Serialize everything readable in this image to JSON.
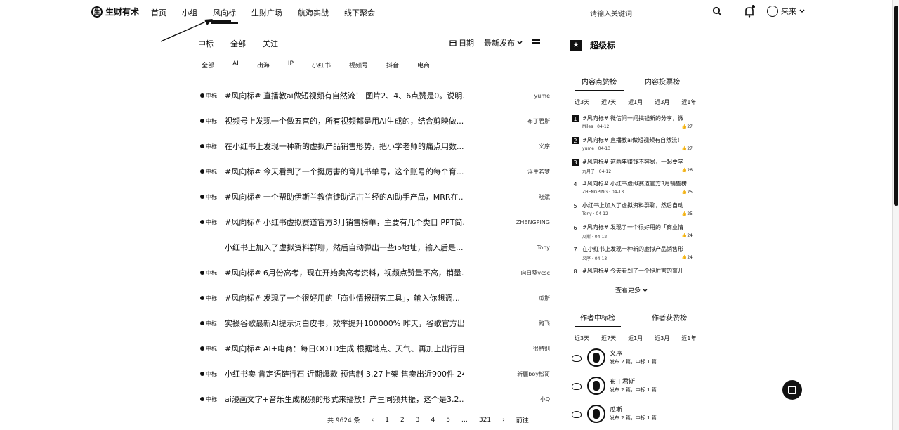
{
  "brand": {
    "name": "生财有术",
    "mark": "生"
  },
  "nav": {
    "items": [
      "首页",
      "小组",
      "风向标",
      "生财广场",
      "航海实战",
      "线下聚会"
    ],
    "active_index": 2
  },
  "search": {
    "placeholder": "请输入关键词"
  },
  "user": {
    "name": "来来"
  },
  "feed": {
    "tabs": [
      "中标",
      "全部",
      "关注"
    ],
    "date_label": "日期",
    "sort_label": "最新发布",
    "categories": [
      "全部",
      "AI",
      "出海",
      "IP",
      "小红书",
      "视频号",
      "抖音",
      "电商"
    ],
    "tag_label": "中标",
    "rows": [
      {
        "tagged": true,
        "title": "#风向标# 直播教ai做短视频有自然流！ 图片2、4、6点赞是0。说明...",
        "author": "yume"
      },
      {
        "tagged": true,
        "title": "视频号上发现一个做五宫的，所有视频都是用AI生成的，结合剪映做...",
        "author": "布丁君斯"
      },
      {
        "tagged": true,
        "title": "在小红书上发现一种新的虚拟产品销售形势，把小学老师的痛点用数...",
        "author": "义序"
      },
      {
        "tagged": true,
        "title": "#风向标# 今天看到了一个挺厉害的育儿书单号，这个账号的每个育...",
        "author": "浮生若梦"
      },
      {
        "tagged": true,
        "title": "#风向标# 一个帮助伊斯兰教信徒助记古兰经的AI助手产品，MRR在...",
        "author": "晓斌"
      },
      {
        "tagged": true,
        "title": "#风向标# 小红书虚拟赛道官方3月销售榜单，主要有几个类目 PPT简...",
        "author": "ZHENGPING"
      },
      {
        "tagged": false,
        "title": "小红书上加入了虚拟资料群聊，然后自动弹出一些ip地址，输入后是...",
        "author": "Tony"
      },
      {
        "tagged": true,
        "title": "#风向标# 6月份高考，现在开始卖高考资料，视频点赞量不高，销量...",
        "author": "向日葵vcsc"
      },
      {
        "tagged": true,
        "title": "#风向标# 发现了一个很好用的「商业情报研究工具」，输入你想调...",
        "author": "瓜斯"
      },
      {
        "tagged": true,
        "title": "实操谷歌最新AI提示词白皮书，效率提升100000% 昨天，谷歌官方出...",
        "author": "路飞"
      },
      {
        "tagged": true,
        "title": "#风向标# AI+电商：每日OOTD生成 根据地点、天气、再加上出行目...",
        "author": "很特别"
      },
      {
        "tagged": true,
        "title": "小红书卖 肯定语链行石 近期爆款 预售制 3.27上架 售卖出近900件 24...",
        "author": "新疆boy松哥"
      },
      {
        "tagged": true,
        "title": "ai漫画文字+音乐生成视频的形式来播放！产生同频共振，这个是3.2...",
        "author": "小Q"
      }
    ]
  },
  "pagination": {
    "total": "共 9624 条",
    "prev": "‹",
    "pages": [
      "1",
      "2",
      "3",
      "4",
      "5",
      "…",
      "321"
    ],
    "next": "›",
    "goto": "前往"
  },
  "sidebar": {
    "title": "超级标",
    "tabs": [
      "内容点赞榜",
      "内容投票榜"
    ],
    "ranges": [
      "近3天",
      "近7天",
      "近1月",
      "近3月",
      "近1年"
    ],
    "ranking": [
      {
        "rank": "1",
        "title": "#风向标# 微信问一问搞钱新的分享，微",
        "author": "Miles",
        "date": "04-12",
        "likes": "27"
      },
      {
        "rank": "2",
        "title": "#风向标# 直播教ai做短视频有自然流！",
        "author": "yume",
        "date": "04-13",
        "likes": "27"
      },
      {
        "rank": "3",
        "title": "#风向标# 这两年赚钱不容易，一起要学",
        "author": "九月子",
        "date": "04-12",
        "likes": "26"
      },
      {
        "rank": "4",
        "title": "#风向标# 小红书虚拟赛道官方3月销售榜",
        "author": "ZHENGPING",
        "date": "04-13",
        "likes": "25"
      },
      {
        "rank": "5",
        "title": "小红书上加入了虚拟资料群聊，然后自动",
        "author": "Tony",
        "date": "04-12",
        "likes": "25"
      },
      {
        "rank": "6",
        "title": "#风向标# 发现了一个很好用的「商业情",
        "author": "瓜斯",
        "date": "04-12",
        "likes": "24"
      },
      {
        "rank": "7",
        "title": "在小红书上发现一种新的虚拟产品销售形",
        "author": "义序",
        "date": "04-13",
        "likes": "24"
      },
      {
        "rank": "8",
        "title": "#风向标# 今天看到了一个挺厉害的育儿",
        "author": "",
        "date": "",
        "likes": ""
      }
    ],
    "more": "查看更多",
    "author_tabs": [
      "作者中标榜",
      "作者获赞榜"
    ],
    "author_ranges": [
      "近3天",
      "近7天",
      "近1月",
      "近3月",
      "近1年"
    ],
    "authors": [
      {
        "name": "义序",
        "meta": "发布 2 篇，中标 1 篇"
      },
      {
        "name": "布丁君斯",
        "meta": "发布 2 篇，中标 1 篇"
      },
      {
        "name": "瓜斯",
        "meta": "发布 2 篇，中标 1 篇"
      }
    ]
  }
}
